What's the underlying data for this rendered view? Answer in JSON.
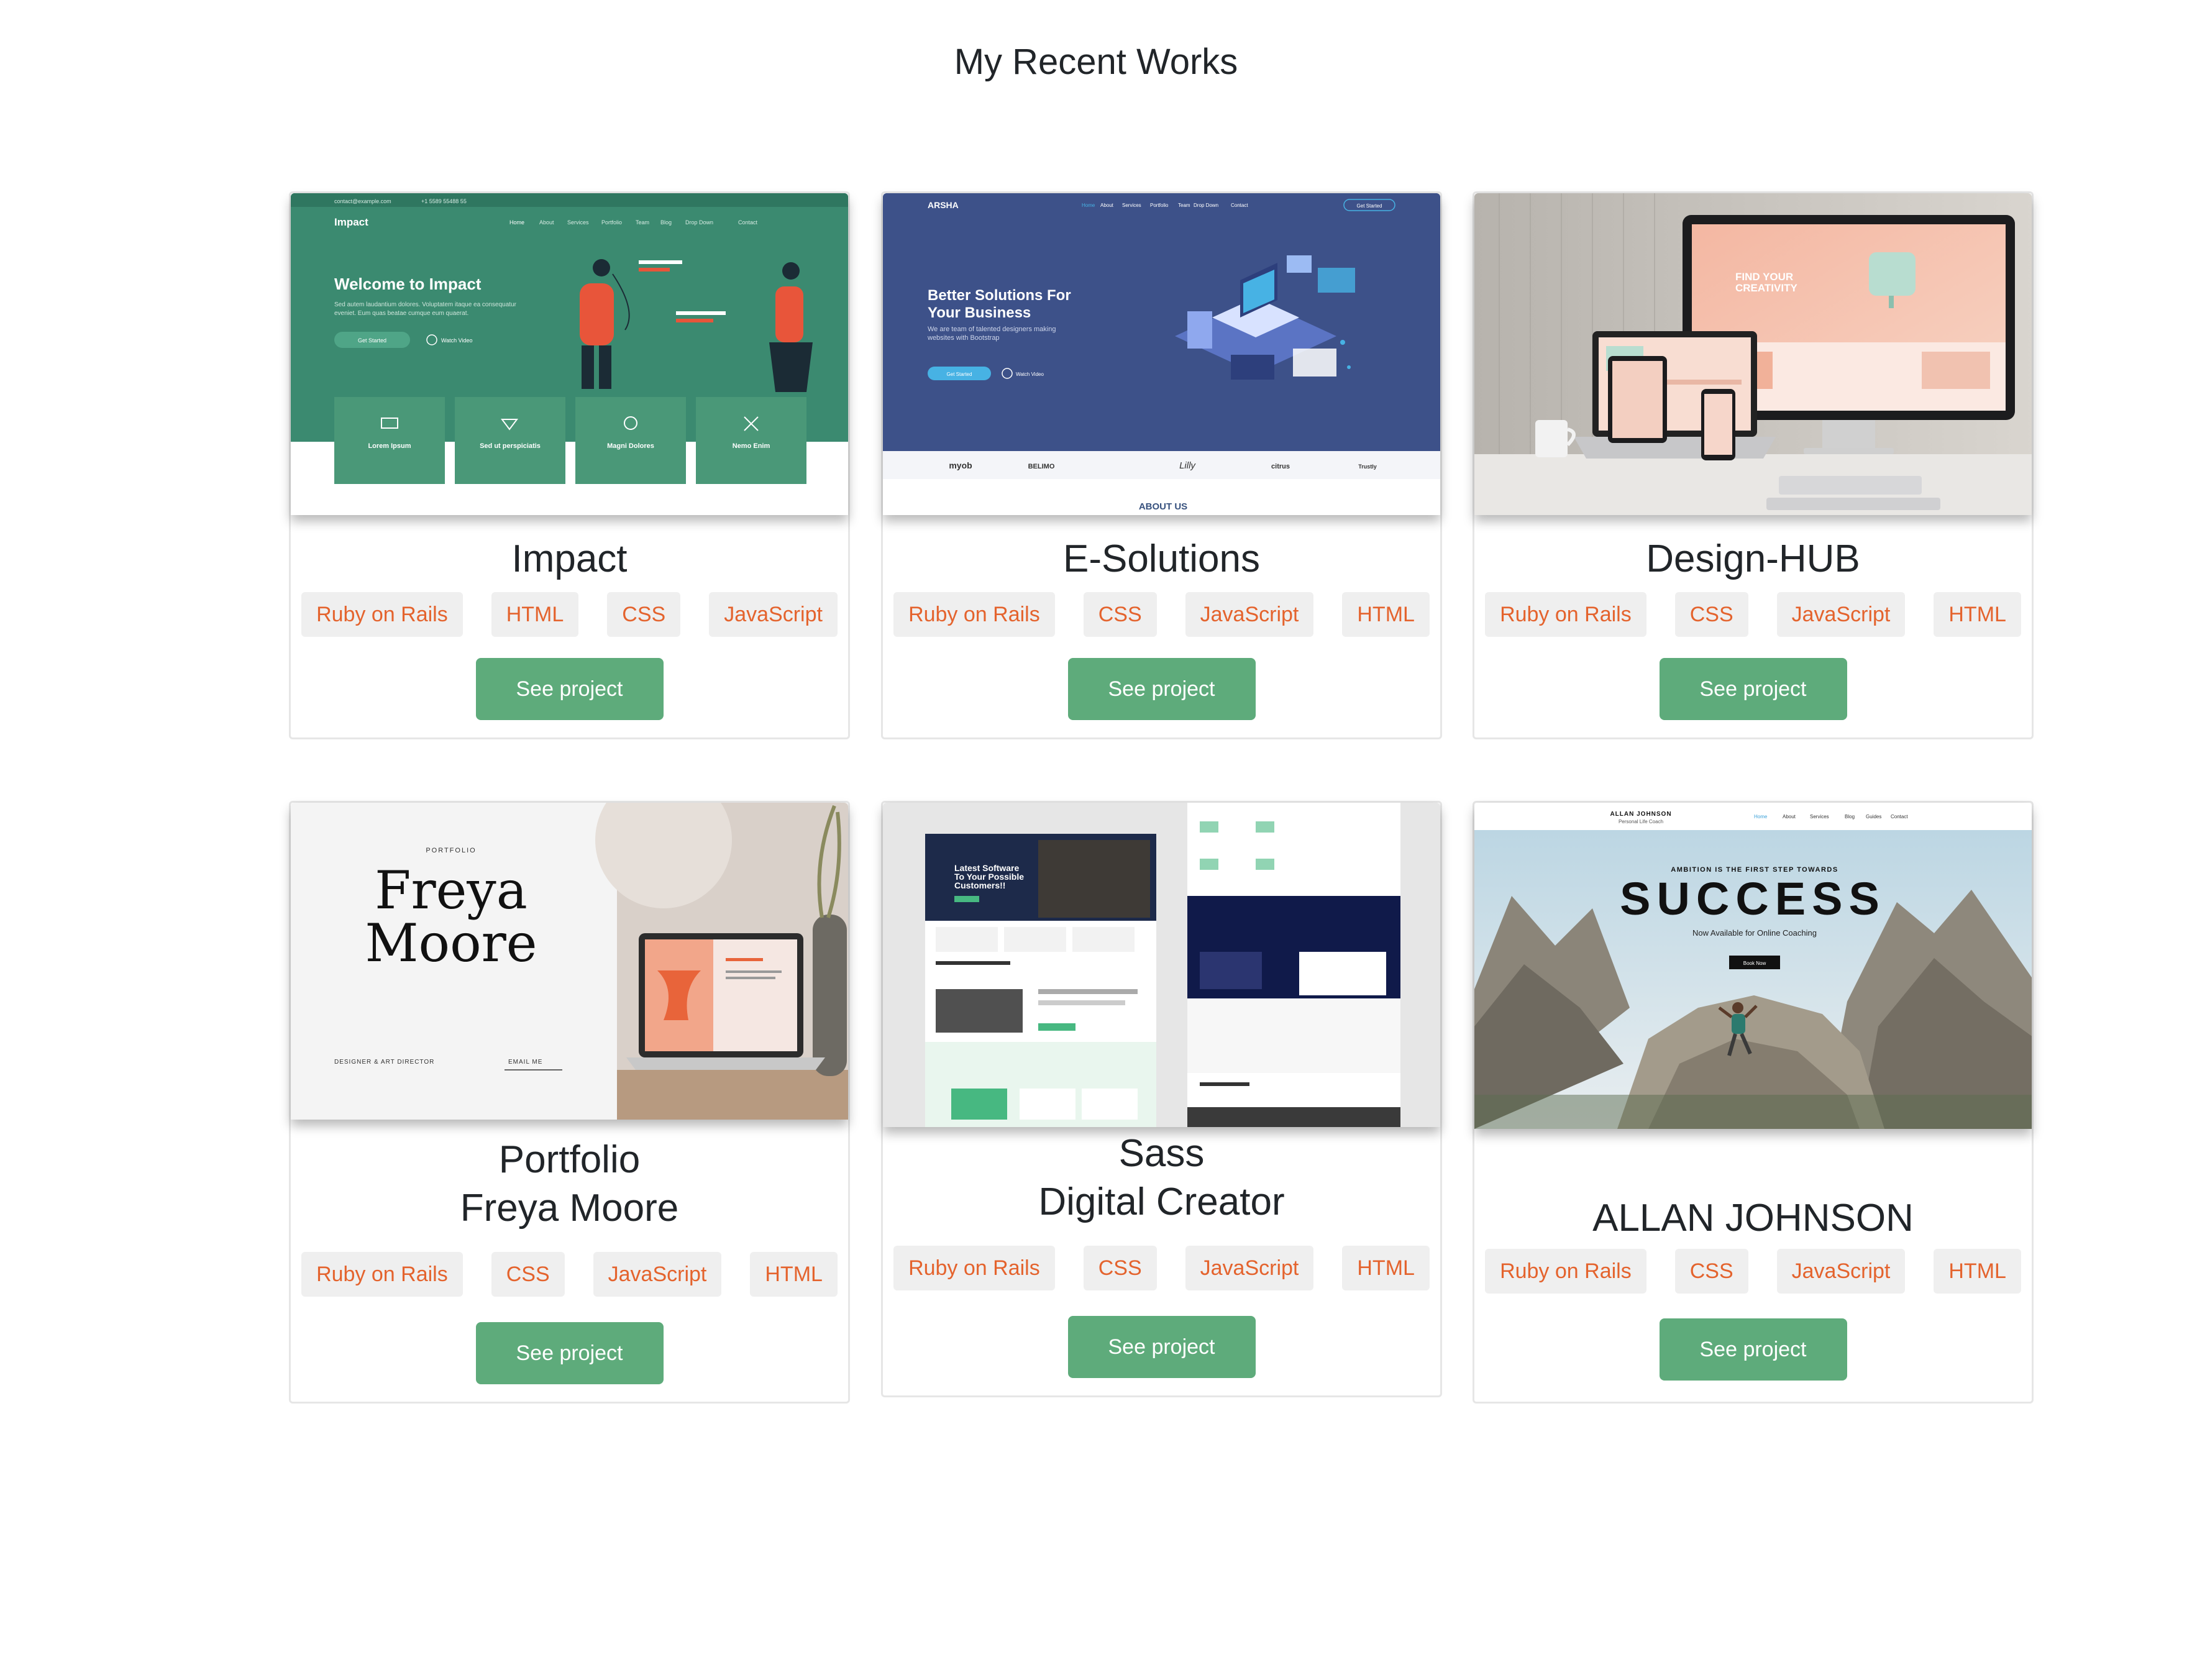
{
  "section": {
    "title": "My Recent Works"
  },
  "projects": [
    {
      "title": "Impact",
      "title_line2": "",
      "tags": [
        "Ruby on Rails",
        "HTML",
        "CSS",
        "JavaScript"
      ],
      "button": "See project",
      "preview": {
        "topbar_email": "contact@example.com",
        "topbar_phone": "+1 5589 55488 55",
        "logo": "Impact",
        "nav": [
          "Home",
          "About",
          "Services",
          "Portfolio",
          "Team",
          "Blog",
          "Drop Down",
          "Contact"
        ],
        "heading": "Welcome to Impact",
        "text_line1": "Sed autem laudantium dolores. Voluptatem itaque ea consequatur",
        "text_line2": "eveniet. Eum quas beatae cumque eum quaerat.",
        "cta": "Get Started",
        "video": "Watch Video",
        "features": [
          "Lorem Ipsum",
          "Sed ut perspiciatis",
          "Magni Dolores",
          "Nemo Enim"
        ]
      }
    },
    {
      "title": "E-Solutions",
      "title_line2": "",
      "tags": [
        "Ruby on Rails",
        "CSS",
        "JavaScript",
        "HTML"
      ],
      "button": "See project",
      "preview": {
        "logo": "ARSHA",
        "nav": [
          "Home",
          "About",
          "Services",
          "Portfolio",
          "Team",
          "Drop Down",
          "Contact"
        ],
        "nav_cta": "Get Started",
        "heading_line1": "Better Solutions For",
        "heading_line2": "Your Business",
        "text_line1": "We are team of talented designers making",
        "text_line2": "websites with Bootstrap",
        "cta": "Get Started",
        "video": "Watch Video",
        "clients": [
          "myob",
          "BELIMO",
          "Lilly",
          "citrus",
          "Trustly"
        ],
        "about": "ABOUT US"
      }
    },
    {
      "title": "Design-HUB",
      "title_line2": "",
      "tags": [
        "Ruby on Rails",
        "CSS",
        "JavaScript",
        "HTML"
      ],
      "button": "See project",
      "preview": {
        "screen_heading_line1": "FIND YOUR",
        "screen_heading_line2": "CREATIVITY"
      }
    },
    {
      "title": "Portfolio",
      "title_line2": "Freya Moore",
      "tags": [
        "Ruby on Rails",
        "CSS",
        "JavaScript",
        "HTML"
      ],
      "button": "See project",
      "preview": {
        "kicker": "PORTFOLIO",
        "name_line1": "Freya",
        "name_line2": "Moore",
        "role": "DESIGNER & ART DIRECTOR",
        "email": "EMAIL ME"
      }
    },
    {
      "title": "Sass",
      "title_line2": "Digital Creator",
      "tags": [
        "Ruby on Rails",
        "CSS",
        "JavaScript",
        "HTML"
      ],
      "button": "See project",
      "preview": {
        "hero_line1": "Latest Software",
        "hero_line2": "To Your Possible",
        "hero_line3": "Customers!!"
      }
    },
    {
      "title": "ALLAN JOHNSON",
      "title_line2": "",
      "tags": [
        "Ruby on Rails",
        "CSS",
        "JavaScript",
        "HTML"
      ],
      "button": "See project",
      "preview": {
        "brand": "ALLAN JOHNSON",
        "brand_sub": "Personal Life Coach",
        "nav": [
          "Home",
          "About",
          "Services",
          "Blog",
          "Guides",
          "Contact"
        ],
        "kicker": "AMBITION IS THE FIRST STEP TOWARDS",
        "headline": "SUCCESS",
        "sub": "Now Available for Online Coaching",
        "cta": "Book Now"
      }
    }
  ]
}
